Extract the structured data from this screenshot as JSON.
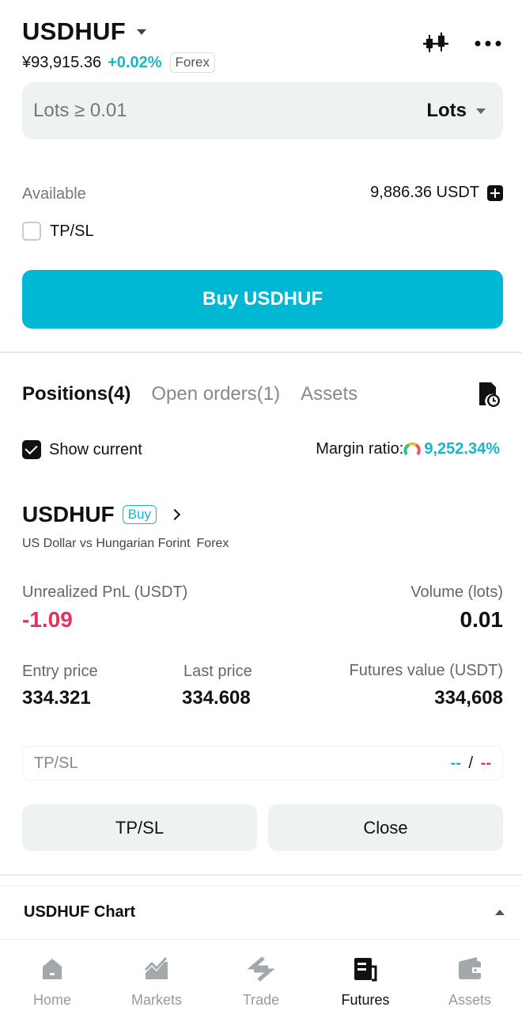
{
  "header": {
    "symbol": "USDHUF",
    "price": "¥93,915.36",
    "change_pct": "+0.02%",
    "market_tag": "Forex"
  },
  "order": {
    "lots_placeholder": "Lots ≥ 0.01",
    "unit_select": "Lots",
    "available_label": "Available",
    "available_value": "9,886.36 USDT",
    "tpsl_checkbox_label": "TP/SL",
    "buy_button": "Buy USDHUF"
  },
  "tabs": [
    {
      "label": "Positions(4)"
    },
    {
      "label": "Open orders(1)"
    },
    {
      "label": "Assets"
    }
  ],
  "filters": {
    "show_current_label": "Show current",
    "margin_ratio_label": "Margin ratio:",
    "margin_ratio_value": "9,252.34%"
  },
  "position": {
    "symbol": "USDHUF",
    "side": "Buy",
    "description": "US Dollar vs Hungarian Forint",
    "market": "Forex",
    "pnl_label": "Unrealized PnL (USDT)",
    "pnl_value": "-1.09",
    "volume_label": "Volume (lots)",
    "volume_value": "0.01",
    "entry_label": "Entry price",
    "entry_value": "334.321",
    "last_label": "Last price",
    "last_value": "334.608",
    "fut_label": "Futures value (USDT)",
    "fut_value": "334,608",
    "tpsl_field_label": "TP/SL",
    "tp_value": "--",
    "sl_sep": "/",
    "sl_value": "--",
    "tpsl_button": "TP/SL",
    "close_button": "Close"
  },
  "chart_section": {
    "title": "USDHUF Chart"
  },
  "bottom_nav": [
    {
      "label": "Home",
      "icon": "home-icon"
    },
    {
      "label": "Markets",
      "icon": "markets-icon"
    },
    {
      "label": "Trade",
      "icon": "trade-icon"
    },
    {
      "label": "Futures",
      "icon": "futures-icon"
    },
    {
      "label": "Assets",
      "icon": "wallet-icon"
    }
  ],
  "colors": {
    "accent": "#00b8d3",
    "positive": "#17b6c8",
    "negative": "#e8315a"
  }
}
